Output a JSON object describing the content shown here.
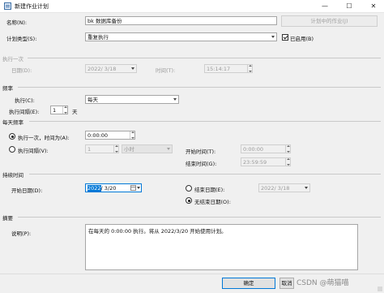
{
  "window": {
    "title": "新建作业计划",
    "minimize_glyph": "—",
    "maximize_glyph": "☐",
    "close_glyph": "✕"
  },
  "general": {
    "name_label": "名称(N):",
    "name_value": "bk 数据库备份",
    "jobs_button": "计划中的作业(J)",
    "schedule_type_label": "计划类型(S):",
    "schedule_type_value": "重复执行",
    "enabled_label": "已启用(B)",
    "enabled_checked": true
  },
  "one_time": {
    "section_label": "执行一次",
    "date_label": "日期(D):",
    "date_value": "2022/ 3/18",
    "time_label": "时间(T):",
    "time_value": "15:14:17"
  },
  "frequency": {
    "section_label": "频率",
    "occurs_label": "执行(C):",
    "occurs_value": "每天",
    "recurs_label": "执行间隔(E):",
    "recurs_value": "1",
    "recurs_unit": "天"
  },
  "daily_frequency": {
    "section_label": "每天频率",
    "once_label": "执行一次，时间为(A):",
    "once_value": "0:00:00",
    "every_label": "执行间隔(V):",
    "every_value": "1",
    "every_unit": "小时",
    "start_label": "开始时间(T):",
    "start_value": "0:00:00",
    "end_label": "结束时间(G):",
    "end_value": "23:59:59"
  },
  "duration": {
    "section_label": "持续时间",
    "start_date_label": "开始日期(D):",
    "start_date_year": "2022",
    "start_date_rest": "/ 3/20",
    "end_date_label": "结束日期(E):",
    "end_date_value": "2022/ 3/18",
    "no_end_label": "无结束日期(O):"
  },
  "summary": {
    "section_label": "摘要",
    "description_label": "说明(P):",
    "description_text": "在每天的 0:00:00 执行。将从 2022/3/20 开始使用计划。"
  },
  "footer": {
    "ok_label": "确定",
    "cancel_label": "取消",
    "watermark": "CSDN @萌猫喵"
  },
  "colors": {
    "accent": "#0078d7",
    "background": "#f0f0f0"
  }
}
